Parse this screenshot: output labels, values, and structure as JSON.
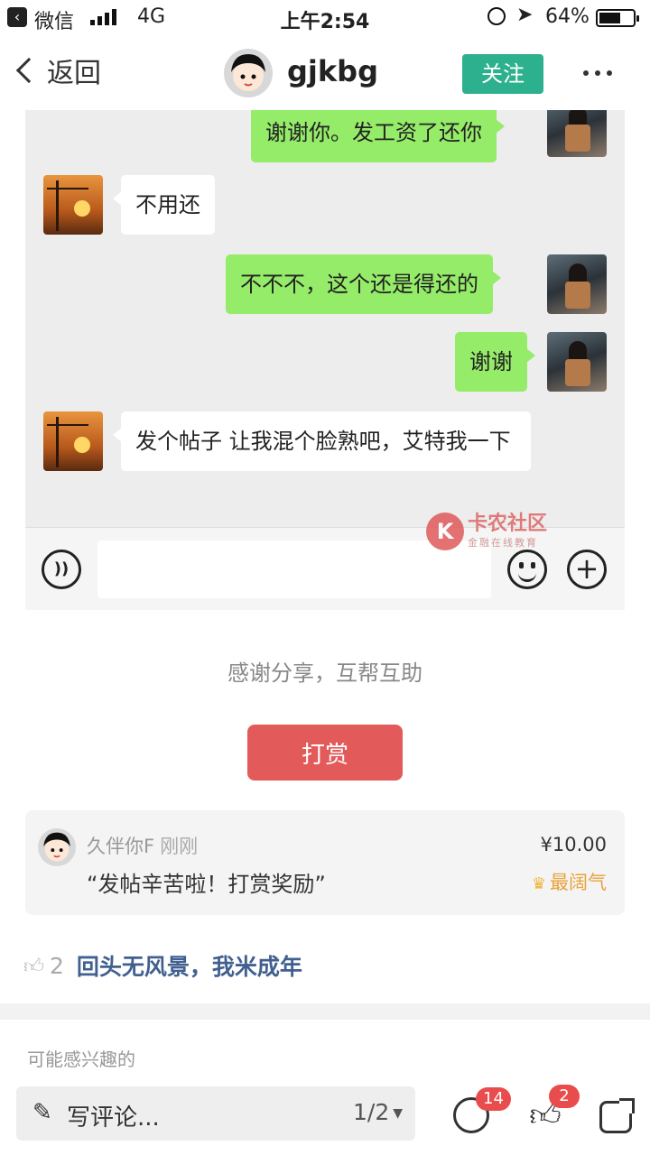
{
  "status_bar": {
    "back_app": "微信",
    "network": "4G",
    "time": "上午2:54",
    "battery": "64%",
    "battery_level": 0.64
  },
  "header": {
    "back_label": "返回",
    "username": "gjkbg",
    "follow_label": "关注"
  },
  "chat": {
    "messages": [
      {
        "side": "right",
        "text": "谢谢你。发工资了还你"
      },
      {
        "side": "left",
        "text": "不用还"
      },
      {
        "side": "right",
        "text": "不不不，这个还是得还的"
      },
      {
        "side": "right",
        "text": "谢谢"
      },
      {
        "side": "left",
        "text": "发个帖子  让我混个脸熟吧，艾特我一下"
      }
    ],
    "watermark_title": "卡农社区",
    "watermark_sub": "金融在线教育"
  },
  "reward": {
    "thanks_text": "感谢分享，互帮互助",
    "button_label": "打赏",
    "entry": {
      "user": "久伴你F",
      "time": "刚刚",
      "message": "“发帖辛苦啦！打赏奖励”",
      "amount": "¥10.00",
      "badge": "最阔气"
    }
  },
  "likes": {
    "count": "2",
    "names": "回头无风景，我米成年"
  },
  "recommend_label": "可能感兴趣的",
  "bottom_bar": {
    "comment_placeholder": "写评论...",
    "page_indicator": "1/2",
    "comments_count": "14",
    "likes_count": "2"
  }
}
